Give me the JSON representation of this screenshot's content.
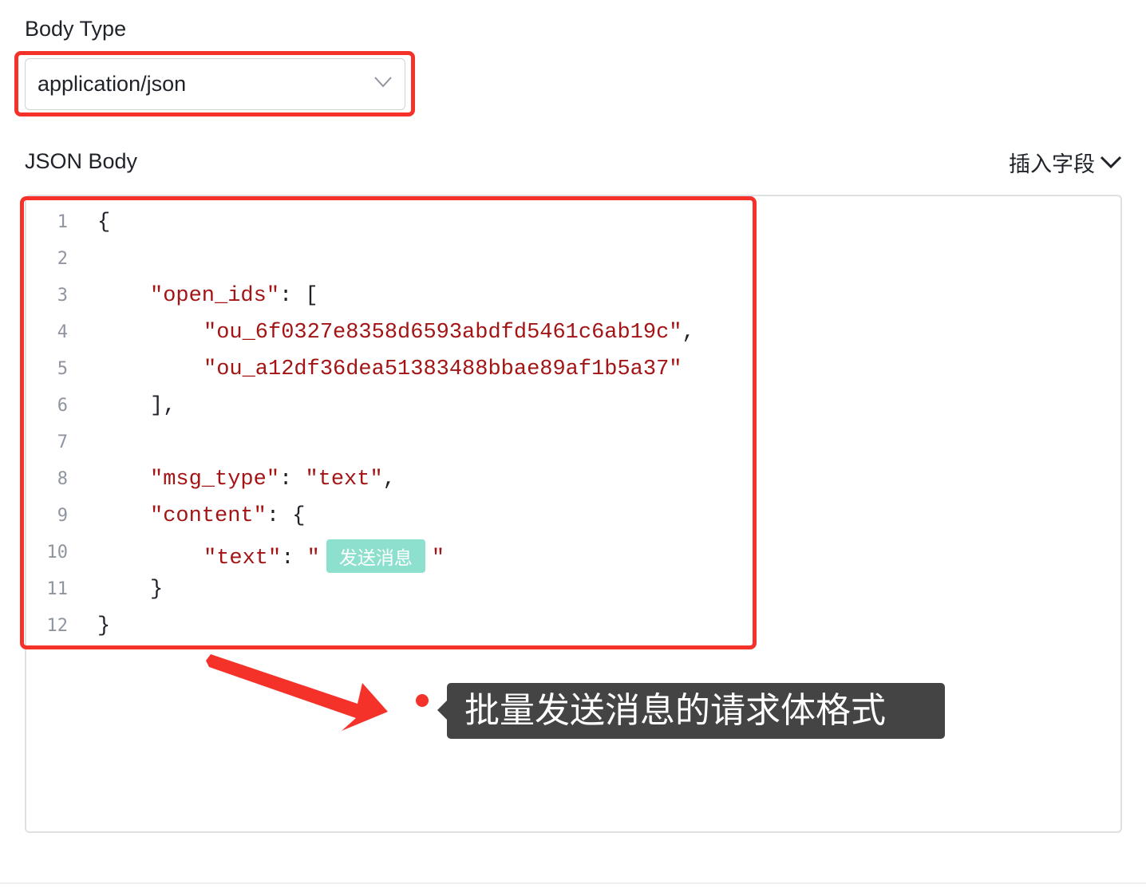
{
  "body_type": {
    "label": "Body Type",
    "selected": "application/json",
    "arrow_icon": "chevron-down-icon"
  },
  "json_body": {
    "label": "JSON Body",
    "insert_field": "插入字段",
    "insert_icon": "chevron-down-icon",
    "line_numbers": [
      "1",
      "2",
      "3",
      "4",
      "5",
      "6",
      "7",
      "8",
      "9",
      "10",
      "11",
      "12"
    ],
    "code": {
      "l1": "{",
      "l3_key": "\"open_ids\"",
      "l3_rest": ": [",
      "l4_val": "\"ou_6f0327e8358d6593abdfd5461c6ab19c\"",
      "l4_rest": ",",
      "l5_val": "\"ou_a12df36dea51383488bbae89af1b5a37\"",
      "l6": "],",
      "l8_key": "\"msg_type\"",
      "l8_colon": ": ",
      "l8_val": "\"text\"",
      "l8_rest": ",",
      "l9_key": "\"content\"",
      "l9_rest": ": {",
      "l10_key": "\"text\"",
      "l10_colon": ": ",
      "l10_open": "\"",
      "l10_var": "发送消息",
      "l10_close": "\"",
      "l11": "}",
      "l12": "}"
    }
  },
  "annotation": {
    "callout_text": "批量发送消息的请求体格式"
  },
  "colors": {
    "highlight_border": "#f5322a",
    "string": "#a31515",
    "variable_tag": "#8ddfce",
    "callout_bg": "#444444"
  }
}
